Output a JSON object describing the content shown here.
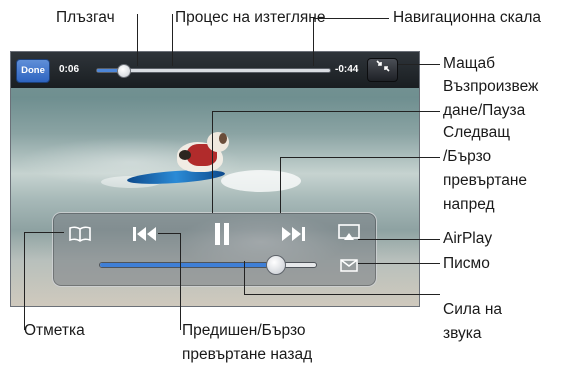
{
  "player": {
    "done_label": "Done",
    "elapsed": "0:06",
    "remaining": "-0:44",
    "playback_progress": 0.12,
    "volume_level": 0.81
  },
  "callouts": {
    "scrubber": "Плъзгач",
    "playback_progress": "Процес на изтегляне",
    "navigation_bar": "Навигационна скала",
    "scale": "Мащаб",
    "play_pause": "Възпроизвеж\nдане/Пауза",
    "next_fast_forward": "Следващ\n/Бързо\nпревъртане\nнапред",
    "airplay": "AirPlay",
    "mail": "Писмо",
    "volume": "Сила на\nзвука",
    "bookmark": "Отметка",
    "previous_rewind": "Предишен/Бързо\nпревъртане назад"
  },
  "icons": {
    "done": "done-button",
    "scale": "scale-toggle-icon",
    "bookmark": "bookmark-book-icon",
    "previous": "previous-rewind-icon",
    "play_pause": "pause-icon",
    "next": "next-fast-forward-icon",
    "airplay": "airplay-icon",
    "mail": "mail-envelope-icon"
  },
  "colors": {
    "accent_blue": "#3f7fd6",
    "done_button": "#2e64c0"
  }
}
